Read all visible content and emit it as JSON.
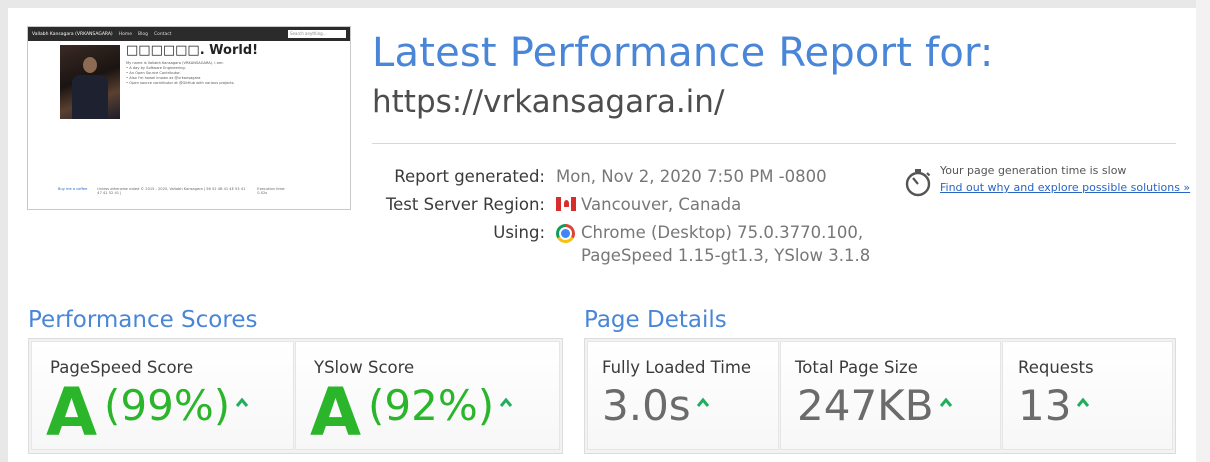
{
  "thumbnail": {
    "brand": "Vallabh Kansagara (VRKANSAGARA)",
    "nav": [
      "Home",
      "Blog",
      "Contact"
    ],
    "search_placeholder": "Search anything...",
    "heading": "□□□□□□. World!",
    "intro": "My name is Vallabh Kansagara (VRKANSAGARA). I am:",
    "bullets": [
      "A day by Software Engineering.",
      "An Open Source Contributor.",
      "Also I'm howel known as @vrkansagara",
      "Open source contributor at @GitHub with various projects."
    ],
    "footer_coffee": "Buy me a coffee",
    "footer_text": "Unless otherwise noted © 2015 - 2020, Vallabh Kansagara | 56 52 4B 41 4E 53 41 47 41 52 41 |",
    "footer_exec": "Execution time: 0.02s"
  },
  "header": {
    "title": "Latest Performance Report for:",
    "url": "https://vrkansagara.in/"
  },
  "report": {
    "generated_label": "Report generated:",
    "generated_value": "Mon, Nov 2, 2020 7:50 PM -0800",
    "region_label": "Test Server Region:",
    "region_value": "Vancouver, Canada",
    "using_label": "Using:",
    "using_line1": "Chrome (Desktop) 75.0.3770.100,",
    "using_line2": "PageSpeed 1.15-gt1.3, YSlow 3.1.8"
  },
  "notice": {
    "text": "Your page generation time is slow",
    "link": "Find out why and explore possible solutions »"
  },
  "performance": {
    "title": "Performance Scores",
    "pagespeed": {
      "label": "PageSpeed Score",
      "grade": "A",
      "percent": "(99%)"
    },
    "yslow": {
      "label": "YSlow Score",
      "grade": "A",
      "percent": "(92%)"
    }
  },
  "details": {
    "title": "Page Details",
    "loaded": {
      "label": "Fully Loaded Time",
      "value": "3.0s"
    },
    "size": {
      "label": "Total Page Size",
      "value": "247KB"
    },
    "requests": {
      "label": "Requests",
      "value": "13"
    }
  },
  "colors": {
    "accent": "#4a86d8",
    "grade": "#2ab52a",
    "arrow": "#1fae5a",
    "link": "#2a64c5"
  },
  "icons": [
    "canada-flag-icon",
    "chrome-icon",
    "stopwatch-icon",
    "arrow-up-icon"
  ]
}
